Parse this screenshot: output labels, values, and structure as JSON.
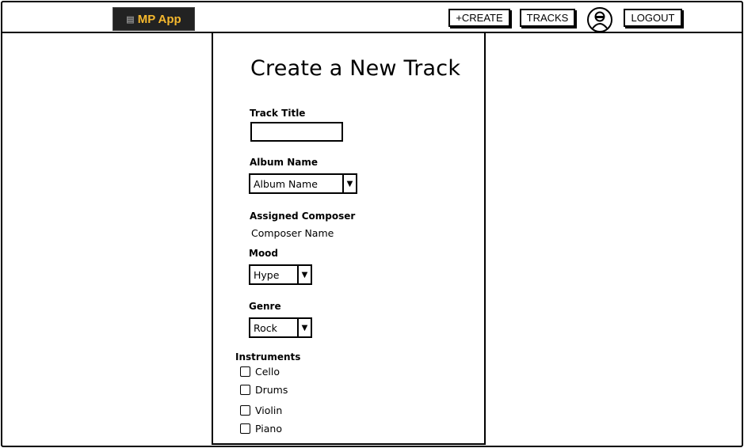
{
  "app": {
    "logo_text": "MP App"
  },
  "nav": {
    "create_label": "+CREATE",
    "tracks_label": "TRACKS",
    "logout_label": "LOGOUT"
  },
  "form": {
    "title": "Create a New Track",
    "track_title": {
      "label": "Track Title",
      "value": ""
    },
    "album": {
      "label": "Album Name",
      "selected": "Album Name"
    },
    "composer": {
      "label": "Assigned Composer",
      "value": "Composer Name"
    },
    "mood": {
      "label": "Mood",
      "selected": "Hype"
    },
    "genre": {
      "label": "Genre",
      "selected": "Rock"
    },
    "instruments": {
      "label": "Instruments",
      "options": [
        "Cello",
        "Drums",
        "Violin",
        "Piano"
      ]
    }
  }
}
